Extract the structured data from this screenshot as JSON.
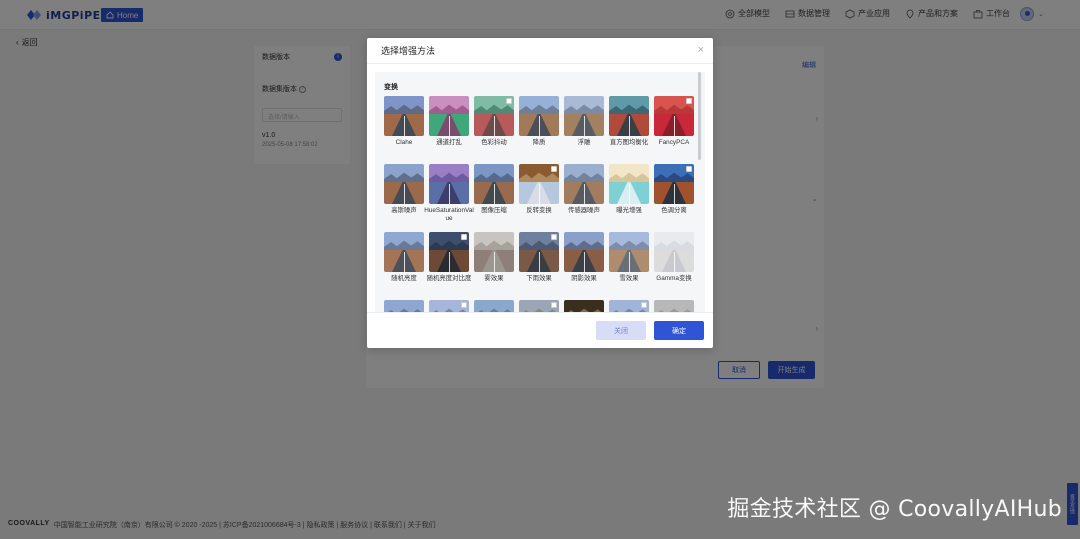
{
  "app": {
    "logo_text": "iMGPiPE",
    "home_label": "Home",
    "nav": [
      {
        "label": "全部模型",
        "icon": "grid-icon"
      },
      {
        "label": "数据管理",
        "icon": "database-icon"
      },
      {
        "label": "产业应用",
        "icon": "cube-icon"
      },
      {
        "label": "产品和方案",
        "icon": "location-icon"
      },
      {
        "label": "工作台",
        "icon": "briefcase-icon"
      }
    ],
    "back_label": "返回"
  },
  "left_panel": {
    "dataset_label": "数据版本",
    "quality_label": "数据集版本",
    "input_placeholder": "选择/请输入",
    "version": "v1.0",
    "date": "2025-05-08 17:58:02"
  },
  "main_panel": {
    "link_label": "编辑",
    "cancel_label": "取消",
    "generate_label": "开始生成"
  },
  "footer": {
    "brand": "COOVALLY",
    "text": "中国智能工业研究院（南京）有限公司 © 2020 -2025 | 苏ICP备2021006684号-3 | 隐私政策 | 服务协议 | 联系我们 | 关于我们"
  },
  "side_float_label": "意见反馈",
  "watermark": "掘金技术社区 @ CoovallyAIHub",
  "modal": {
    "title": "选择增强方法",
    "close_symbol": "×",
    "section_title": "变换",
    "close_btn": "关闭",
    "ok_btn": "确定",
    "items": [
      {
        "label": "Clahe",
        "sky": "#7f95c9",
        "mtn": "#5d6a88",
        "ground": "#a06a4a",
        "road": "#444a52"
      },
      {
        "label": "通道打乱",
        "sky": "#c98fbf",
        "mtn": "#a35c8f",
        "ground": "#3fa77a",
        "road": "#7a4c6e"
      },
      {
        "label": "色彩抖动",
        "sky": "#7fbca4",
        "mtn": "#4f8a75",
        "ground": "#b85a5a",
        "road": "#6e4a4a"
      },
      {
        "label": "降质",
        "sky": "#97b0d8",
        "mtn": "#6e7f99",
        "ground": "#a27a5a",
        "road": "#4c4f57"
      },
      {
        "label": "浮雕",
        "sky": "#a8bad6",
        "mtn": "#7d8aa3",
        "ground": "#a3805f",
        "road": "#575b63"
      },
      {
        "label": "直方图均衡化",
        "sky": "#5f9aa8",
        "mtn": "#3a6874",
        "ground": "#b04a3a",
        "road": "#3a3e46"
      },
      {
        "label": "FancyPCA",
        "sky": "#d9544f",
        "mtn": "#b83a38",
        "ground": "#c8283a",
        "road": "#8a1f2c"
      },
      {
        "label": "高斯噪声",
        "sky": "#8aa2cc",
        "mtn": "#5f6f8c",
        "ground": "#9c6a4a",
        "road": "#474b53"
      },
      {
        "label": "HueSaturationValue",
        "sky": "#9a7fc7",
        "mtn": "#6f5aa0",
        "ground": "#5a6fa8",
        "road": "#3e3e6a"
      },
      {
        "label": "图像压缩",
        "sky": "#7d97c4",
        "mtn": "#566a8c",
        "ground": "#9a6a4e",
        "road": "#44484f"
      },
      {
        "label": "反转变换",
        "sky": "#8a5a30",
        "mtn": "#b08a5c",
        "ground": "#b5c8e0",
        "road": "#d8dce4"
      },
      {
        "label": "传感器噪声",
        "sky": "#9bb0d0",
        "mtn": "#74829c",
        "ground": "#a17c5e",
        "road": "#575a60"
      },
      {
        "label": "曝光增强",
        "sky": "#f1e6c8",
        "mtn": "#d9c59a",
        "ground": "#7fd0d4",
        "road": "#d9eef0"
      },
      {
        "label": "色调分离",
        "sky": "#3b6fb8",
        "mtn": "#2a4a80",
        "ground": "#a0522d",
        "road": "#2f3238"
      },
      {
        "label": "随机亮度",
        "sky": "#8ea8d2",
        "mtn": "#6a7a96",
        "ground": "#a47456",
        "road": "#4e5258"
      },
      {
        "label": "随机亮度对比度",
        "sky": "#3e4f6e",
        "mtn": "#2c3a52",
        "ground": "#6e4a36",
        "road": "#2a2c32"
      },
      {
        "label": "雾效果",
        "sky": "#c9c4c0",
        "mtn": "#a8a29c",
        "ground": "#8e8078",
        "road": "#9a9690"
      },
      {
        "label": "下雨效果",
        "sky": "#6e809e",
        "mtn": "#4c5a74",
        "ground": "#7a5a46",
        "road": "#3a3d44"
      },
      {
        "label": "阴影效果",
        "sky": "#8aa0c8",
        "mtn": "#5f6d88",
        "ground": "#8a5e44",
        "road": "#3c3f46"
      },
      {
        "label": "雪效果",
        "sky": "#a6bade",
        "mtn": "#7f8daa",
        "ground": "#b08c6e",
        "road": "#6a6e76"
      },
      {
        "label": "Gamma变换",
        "sky": "#e8eaee",
        "mtn": "#d8dbe0",
        "ground": "#dcdcdc",
        "road": "#c8cacf"
      },
      {
        "label": "",
        "sky": "#8ea6d0",
        "mtn": "#6a7a96",
        "ground": "#a07658",
        "road": "#4c5058"
      },
      {
        "label": "",
        "sky": "#a5b6da",
        "mtn": "#7a88a6",
        "ground": "#a98466",
        "road": "#5a5e66"
      },
      {
        "label": "",
        "sky": "#8aa8cc",
        "mtn": "#6a7f98",
        "ground": "#8a7a6a",
        "road": "#4c5058"
      },
      {
        "label": "",
        "sky": "#9aa6b6",
        "mtn": "#8a8a7a",
        "ground": "#9a8a6a",
        "road": "#5a5a5a"
      },
      {
        "label": "",
        "sky": "#3a2e1e",
        "mtn": "#8a6a2a",
        "ground": "#4a3a2a",
        "road": "#2a2a2a"
      },
      {
        "label": "",
        "sky": "#9fb4d8",
        "mtn": "#7988a4",
        "ground": "#a88466",
        "road": "#5a5e66"
      },
      {
        "label": "",
        "sky": "#b8b8b8",
        "mtn": "#9a9a9a",
        "ground": "#8c8c8c",
        "road": "#6a6a6a"
      },
      {
        "label": "",
        "sky": "#a6d0d6",
        "mtn": "#86a8b0",
        "ground": "#a0a8a8",
        "road": "#7a8088"
      }
    ],
    "checked_indices": [
      2,
      6,
      10,
      13,
      15,
      17,
      22,
      24,
      26
    ]
  }
}
